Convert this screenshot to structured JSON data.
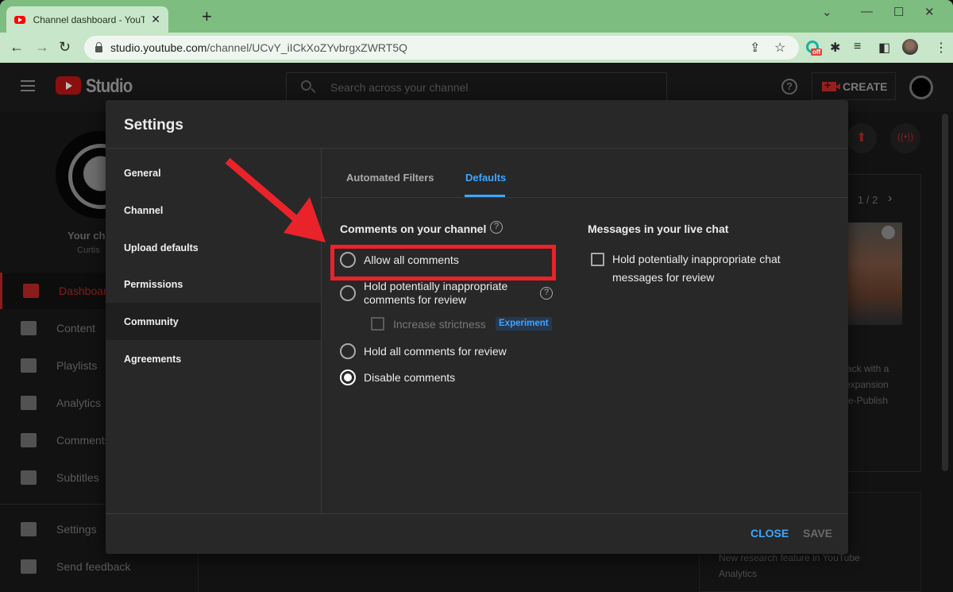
{
  "browser": {
    "tab_title": "Channel dashboard - YouTube Studio",
    "tab_title_visible": "Channel dashboard - YouTube St",
    "new_tab": "+",
    "url_host": "studio.youtube.com",
    "url_path": "/channel/UCvY_iICkXoZYvbrgxZWRT5Q",
    "extension_badge": "off",
    "window_controls": [
      "chevron-down",
      "minimize",
      "maximize",
      "close"
    ]
  },
  "studio": {
    "logo_text": "Studio",
    "search_placeholder": "Search across your channel",
    "create_label": "CREATE",
    "help_glyph": "?",
    "channel": {
      "title": "Your channel",
      "name": "Curtis"
    },
    "sidebar": [
      {
        "label": "Dashboard",
        "icon": "dashboard-icon",
        "active": true
      },
      {
        "label": "Content",
        "icon": "content-icon",
        "active": false
      },
      {
        "label": "Playlists",
        "icon": "playlists-icon",
        "active": false
      },
      {
        "label": "Analytics",
        "icon": "analytics-icon",
        "active": false
      },
      {
        "label": "Comments",
        "icon": "comments-icon",
        "active": false
      },
      {
        "label": "Subtitles",
        "icon": "subtitles-icon",
        "active": false
      },
      {
        "label": "Settings",
        "icon": "gear-icon",
        "active": false
      },
      {
        "label": "Send feedback",
        "icon": "feedback-icon",
        "active": false
      }
    ],
    "right": {
      "pager": "1 / 2",
      "card_text": [
        "ack with a",
        "expansion",
        "re-Publish"
      ],
      "news_text": [
        "New research feature in YouTube",
        "Analytics"
      ]
    }
  },
  "settings_modal": {
    "title": "Settings",
    "nav": [
      {
        "label": "General",
        "active": false
      },
      {
        "label": "Channel",
        "active": false
      },
      {
        "label": "Upload defaults",
        "active": false
      },
      {
        "label": "Permissions",
        "active": false
      },
      {
        "label": "Community",
        "active": true
      },
      {
        "label": "Agreements",
        "active": false
      }
    ],
    "tabs": [
      {
        "label": "Automated Filters",
        "active": false
      },
      {
        "label": "Defaults",
        "active": true
      }
    ],
    "comments_section": {
      "title": "Comments on your channel",
      "options": [
        {
          "label": "Allow all comments",
          "checked": false
        },
        {
          "label": "Hold potentially inappropriate comments for review",
          "line1": "Hold potentially inappropriate",
          "line2": "comments for review",
          "checked": false
        },
        {
          "label": "Hold all comments for review",
          "checked": false
        },
        {
          "label": "Disable comments",
          "checked": true
        }
      ],
      "sub_option": {
        "label": "Increase strictness",
        "checked": false,
        "disabled": true,
        "badge": "Experiment"
      }
    },
    "live_chat_section": {
      "title": "Messages in your live chat",
      "option": {
        "line1": "Hold potentially inappropriate chat",
        "line2": "messages for review",
        "checked": false
      }
    },
    "footer": {
      "close_label": "CLOSE",
      "save_label": "SAVE"
    }
  },
  "annotation": {
    "color": "#e8232a",
    "target": "Allow all comments"
  },
  "colors": {
    "accent_blue": "#3ea6ff",
    "annotation_red": "#e8232a",
    "modal_bg": "#282828"
  }
}
